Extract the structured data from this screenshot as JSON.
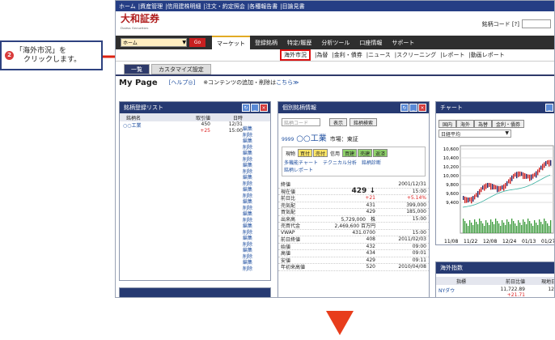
{
  "callout": {
    "number": "2",
    "line1": "「海外市況」を",
    "line2": "クリックします。"
  },
  "topnav": [
    "ホーム",
    "資産管理",
    "信用建株明細",
    "注文・約定照会",
    "各種報告書",
    "目論見書"
  ],
  "logo": {
    "name": "大和証券",
    "sub": "Daiwa Securities"
  },
  "code_label": "銘柄コード [?]",
  "mainnav": {
    "select_value": "ホーム",
    "go": "Go",
    "tabs": [
      "マーケット",
      "登録銘柄",
      "特定/履歴",
      "分析ツール",
      "口座情報",
      "サポート"
    ]
  },
  "subnav": {
    "items": [
      "海外市況",
      "為替",
      "金利・債券",
      "ニュース",
      "スクリーニング",
      "レポート",
      "動画レポート"
    ]
  },
  "subtabs": [
    "一覧",
    "カスタマイズ設定"
  ],
  "mypage": {
    "title": "My Page",
    "help": "[ヘルプ◎]",
    "note": "※コンテンツの追加・削除は",
    "link": "こちら≫"
  },
  "watchlist": {
    "title": "銘柄登録リスト",
    "cols": [
      "銘柄名",
      "取引値",
      "日時"
    ],
    "row": {
      "name": "○○工業",
      "price": "450",
      "change": "+25",
      "date": "12/31",
      "time": "15:00"
    },
    "edit": "編集",
    "del": "削除"
  },
  "stock": {
    "title": "個別銘柄情報",
    "code_ph": "銘柄コード",
    "show": "表示",
    "search": "銘柄検索",
    "code": "9999",
    "name": "○○工業",
    "market": "市場：東証",
    "actions": [
      "現物",
      "買付",
      "売付",
      "信用",
      "買建",
      "売建",
      "返済"
    ],
    "links": [
      "多機能チャート",
      "テクニカル分析",
      "銘柄診断",
      "銘柄レポート"
    ],
    "rows": [
      [
        "終値",
        "",
        "2001/12/31"
      ],
      [
        "現在値",
        "429 ↓",
        "15:00"
      ],
      [
        "前日比",
        "+21",
        "+5.14%"
      ],
      [
        "売気配",
        "431",
        "399,000"
      ],
      [
        "買気配",
        "429",
        "185,000"
      ],
      [
        "出来高",
        "5,729,000　株",
        "15:00"
      ],
      [
        "売買代金",
        "2,469,600 百万円",
        ""
      ],
      [
        "VWAP",
        "431.0700",
        "15:00"
      ],
      [
        "前日終値",
        "408",
        "2011/02/03"
      ],
      [
        "始値",
        "432",
        "09:00"
      ],
      [
        "高値",
        "434",
        "09:01"
      ],
      [
        "安値",
        "429",
        "09:11"
      ],
      [
        "年初来高値",
        "520",
        "2010/04/08"
      ]
    ]
  },
  "chart": {
    "title": "チャート",
    "tabs": [
      "国内",
      "海外",
      "為替",
      "金利・債券"
    ],
    "select": "日経平均",
    "yticks": [
      "10,600",
      "10,400",
      "10,200",
      "10,000",
      "9,800",
      "9,600",
      "9,400"
    ],
    "xticks": [
      "11/08",
      "11/22",
      "12/08",
      "12/24",
      "01/13",
      "01/27"
    ]
  },
  "fx": {
    "title": "海外指数",
    "cols": [
      "指標",
      "前日比値",
      "現地日"
    ],
    "row": {
      "name": "NYダウ",
      "value": "11,722.89",
      "change": "+21.71",
      "date": "12/"
    }
  }
}
